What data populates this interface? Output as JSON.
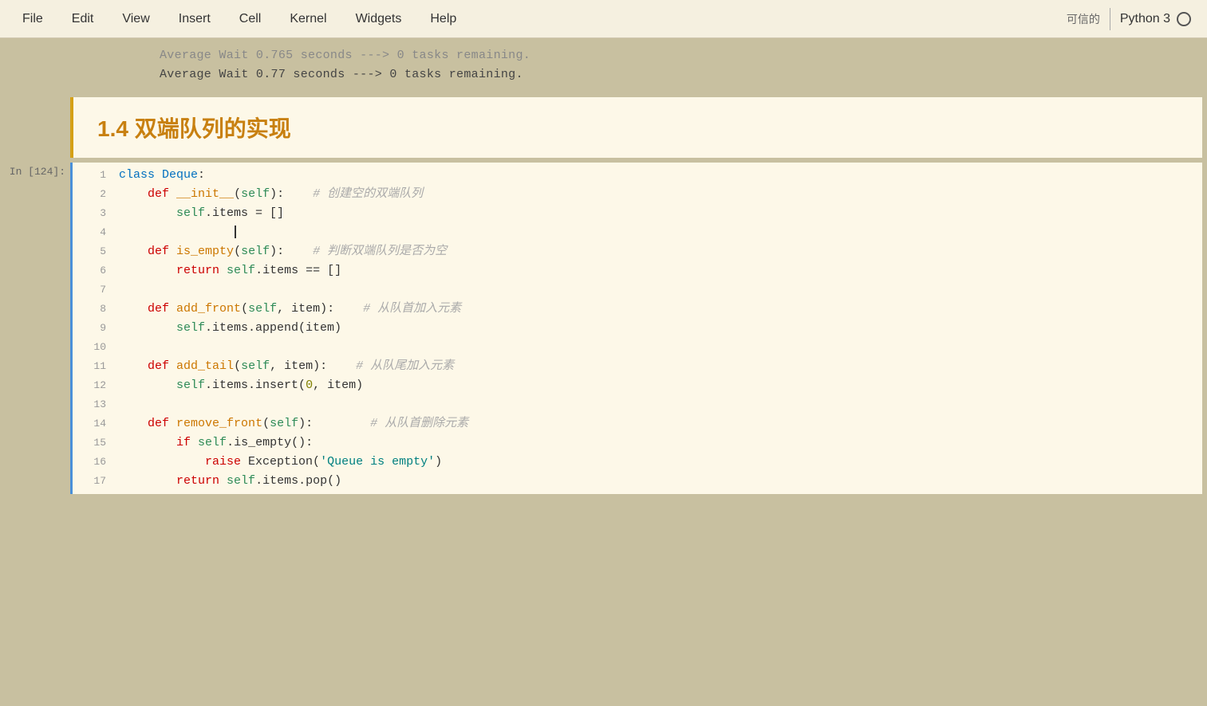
{
  "menubar": {
    "items": [
      "File",
      "Edit",
      "View",
      "Insert",
      "Cell",
      "Kernel",
      "Widgets",
      "Help"
    ],
    "trusted": "可信的",
    "kernel": "Python 3"
  },
  "output": {
    "line1": "Average Wait    0.765 seconds --->  0 tasks remaining.",
    "line2": "Average Wait    0.77 seconds --->  0 tasks remaining."
  },
  "heading": {
    "text": "1.4  双端队列的实现"
  },
  "cell_label": "In [124]:",
  "code": {
    "lines": [
      {
        "num": "1",
        "content": "class Deque:"
      },
      {
        "num": "2",
        "content": "    def __init__(self):    # 创建空的双端队列"
      },
      {
        "num": "3",
        "content": "        self.items = []"
      },
      {
        "num": "4",
        "content": ""
      },
      {
        "num": "5",
        "content": "    def is_empty(self):    # 判断双端队列是否为空"
      },
      {
        "num": "6",
        "content": "        return self.items == []"
      },
      {
        "num": "7",
        "content": ""
      },
      {
        "num": "8",
        "content": "    def add_front(self, item):    # 从队首加入元素"
      },
      {
        "num": "9",
        "content": "        self.items.append(item)"
      },
      {
        "num": "10",
        "content": ""
      },
      {
        "num": "11",
        "content": "    def add_tail(self, item):    # 从队尾加入元素"
      },
      {
        "num": "12",
        "content": "        self.items.insert(0, item)"
      },
      {
        "num": "13",
        "content": ""
      },
      {
        "num": "14",
        "content": "    def remove_front(self):        # 从队首删除元素"
      },
      {
        "num": "15",
        "content": "        if self.is_empty():"
      },
      {
        "num": "16",
        "content": "            raise Exception('Queue is empty')"
      },
      {
        "num": "17",
        "content": "        return self.items.pop()"
      }
    ]
  }
}
